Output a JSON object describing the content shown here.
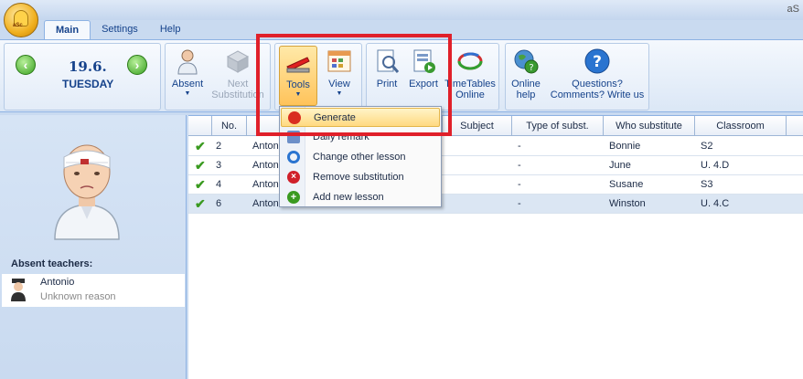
{
  "app": {
    "title": "aS"
  },
  "tabs": [
    {
      "label": "Main",
      "active": true
    },
    {
      "label": "Settings",
      "active": false
    },
    {
      "label": "Help",
      "active": false
    }
  ],
  "date": {
    "day_month": "19.6.",
    "weekday": "TUESDAY"
  },
  "ribbon": {
    "absent": "Absent",
    "next_line1": "Next",
    "next_line2": "Substitution",
    "tools": "Tools",
    "view": "View",
    "print": "Print",
    "export": "Export",
    "timetables_line1": "TimeTables",
    "timetables_line2": "Online",
    "online_help_line1": "Online",
    "online_help_line2": "help",
    "questions_line1": "Questions?",
    "questions_line2": "Comments? Write us"
  },
  "tools_menu": {
    "items": [
      {
        "label": "Generate",
        "icon": "generate-icon",
        "color": "#d92d20",
        "highlighted": true
      },
      {
        "label": "Daily remark",
        "icon": "remark-icon",
        "color": "#6c8fc8",
        "highlighted": false
      },
      {
        "label": "Change other lesson",
        "icon": "refresh-icon",
        "color": "#2a74d0",
        "highlighted": false
      },
      {
        "label": "Remove substitution",
        "icon": "remove-icon",
        "color": "#d0202a",
        "highlighted": false
      },
      {
        "label": "Add new lesson",
        "icon": "add-icon",
        "color": "#3a9a20",
        "highlighted": false
      }
    ]
  },
  "left_panel": {
    "absent_label": "Absent teachers:",
    "teacher_name": "Antonio",
    "teacher_reason": "Unknown reason"
  },
  "table": {
    "headers": {
      "no": "No.",
      "teacher": "",
      "subject": "Subject",
      "type": "Type of subst.",
      "who": "Who substitute",
      "classroom": "Classroom"
    },
    "rows": [
      {
        "no": "2",
        "teacher": "Antonio",
        "subject": "",
        "type": "-",
        "who": "Bonnie",
        "classroom": "S2",
        "selected": false
      },
      {
        "no": "3",
        "teacher": "Antonio",
        "subject": "",
        "type": "-",
        "who": "June",
        "classroom": "U. 4.D",
        "selected": false
      },
      {
        "no": "4",
        "teacher": "Antonio",
        "subject": "",
        "type": "-",
        "who": "Susane",
        "classroom": "S3",
        "selected": false
      },
      {
        "no": "6",
        "teacher": "Antonio",
        "subject": "",
        "type": "-",
        "who": "Winston",
        "classroom": "U. 4.C",
        "selected": true
      }
    ]
  },
  "colors": {
    "highlight_frame": "#e0202a",
    "ribbon_text": "#15428b"
  }
}
